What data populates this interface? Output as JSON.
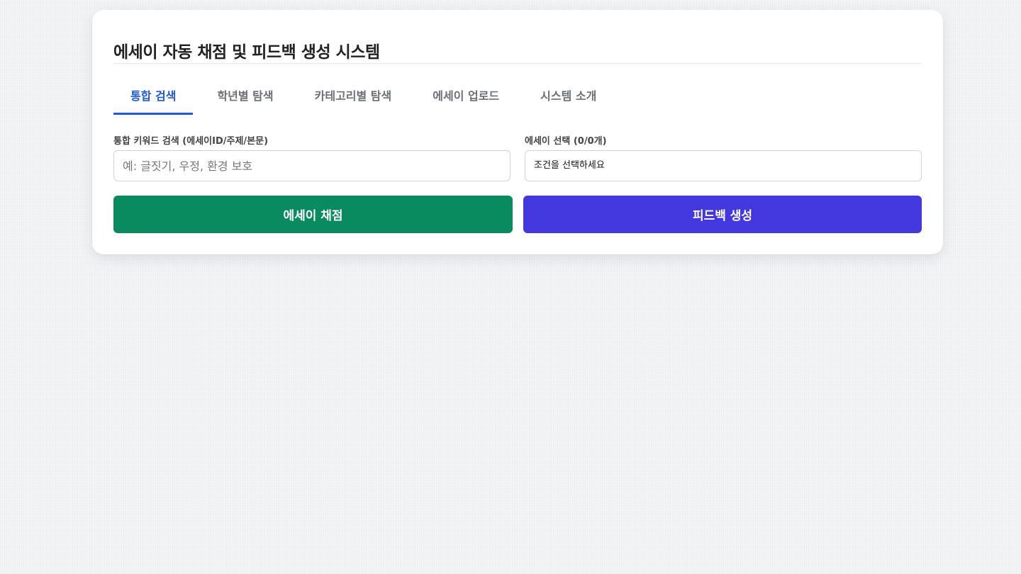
{
  "app": {
    "title": "에세이 자동 채점 및 피드백 생성 시스템"
  },
  "tabs": [
    {
      "label": "통합 검색",
      "active": true
    },
    {
      "label": "학년별 탐색",
      "active": false
    },
    {
      "label": "카테고리별 탐색",
      "active": false
    },
    {
      "label": "에세이 업로드",
      "active": false
    },
    {
      "label": "시스템 소개",
      "active": false
    }
  ],
  "search": {
    "label": "통합 키워드 검색 (에세이ID/주제/본문)",
    "value": "",
    "placeholder": "예: 글짓기, 우정, 환경 보호"
  },
  "essay_select": {
    "label": "에세이 선택 (0/0개)",
    "selected": "조건을 선택하세요"
  },
  "actions": {
    "score_label": "에세이 채점",
    "feedback_label": "피드백 생성"
  },
  "colors": {
    "accent": "#1e5bd8",
    "score_button": "#0a8a5f",
    "feedback_button": "#4338dd",
    "background": "#f3f5f7"
  }
}
